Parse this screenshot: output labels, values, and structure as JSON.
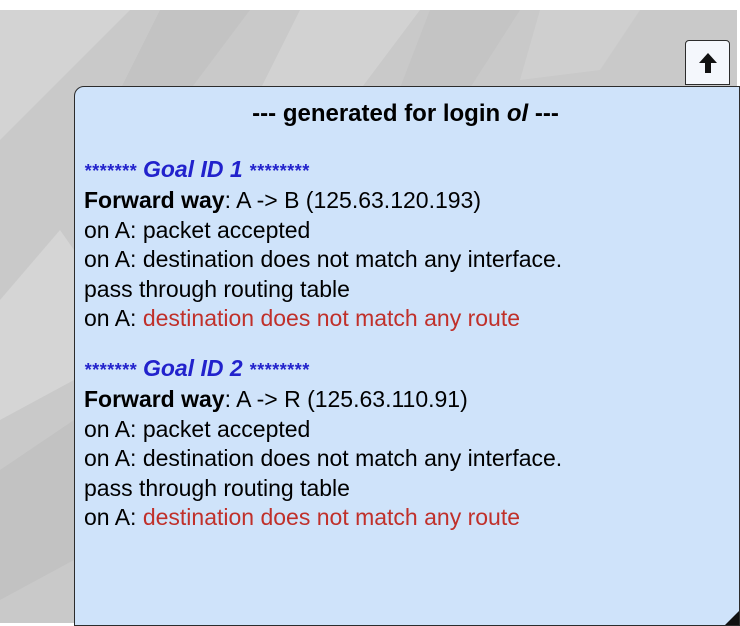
{
  "header": {
    "prefix": "--- generated for login ",
    "login": "ol",
    "suffix": " ---"
  },
  "collapse_icon": "arrow-up-icon",
  "goals": [
    {
      "stars_left": "*******",
      "title": "Goal ID 1",
      "stars_right": "********",
      "forward_label": "Forward way",
      "forward_value": ": A -> B (125.63.120.193)",
      "line_accepted": "on A: packet accepted",
      "line_no_interface": "on A: destination does not match any interface.",
      "line_routing": "pass through routing table",
      "line_route_prefix": "on A: ",
      "line_route_error": "destination does not match any route"
    },
    {
      "stars_left": "*******",
      "title": "Goal ID 2",
      "stars_right": "********",
      "forward_label": "Forward way",
      "forward_value": ": A -> R (125.63.110.91)",
      "line_accepted": "on A: packet accepted",
      "line_no_interface": "on A: destination does not match any interface.",
      "line_routing": "pass through routing table",
      "line_route_prefix": "on A: ",
      "line_route_error": "destination does not match any route"
    }
  ],
  "colors": {
    "panel_background": "#cfe3fa",
    "goal_heading": "#2222cc",
    "error_text": "#c0302a",
    "backdrop": "#c9c9c9"
  }
}
